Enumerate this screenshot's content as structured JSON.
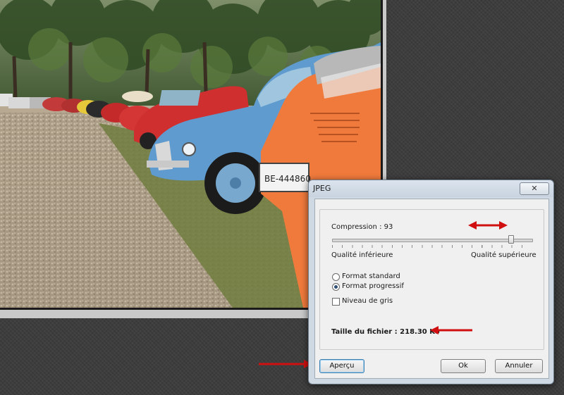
{
  "photo": {
    "plate_text": "BE-444860"
  },
  "dialog": {
    "title": "JPEG",
    "close_glyph": "✕",
    "compression_label": "Compression : 93",
    "compression_value": 93,
    "compression_fraction": 0.93,
    "slider_min_label": "Qualité inférieure",
    "slider_max_label": "Qualité supérieure",
    "format_standard_label": "Format standard",
    "format_progressive_label": "Format progressif",
    "format_selected": "Format progressif",
    "grayscale_label": "Niveau de gris",
    "grayscale_checked": false,
    "file_size_label": "Taille du fichier : 218.30 Ko",
    "preview_button": "Aperçu",
    "ok_button": "Ok",
    "cancel_button": "Annuler"
  },
  "colors": {
    "annotation_arrow": "#d01010",
    "dialog_frame": "#cfd9e4",
    "default_button_border": "#3c7fb1"
  },
  "icons": {
    "close": "close-icon",
    "arrows": [
      "double-arrow-icon",
      "left-arrow-icon",
      "right-arrow-icon"
    ]
  }
}
